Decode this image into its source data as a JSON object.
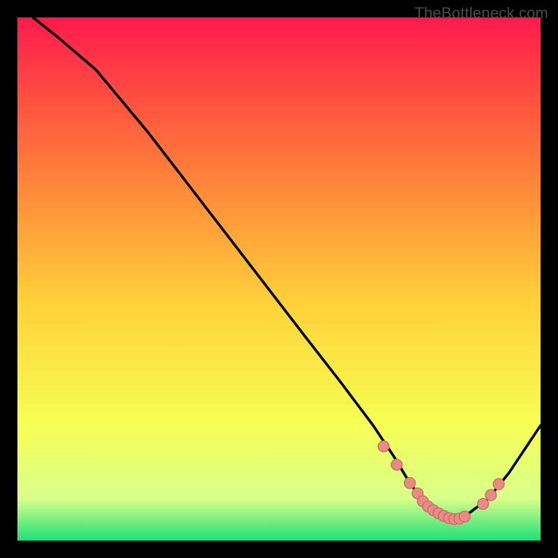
{
  "watermark": "TheBottleneck.com",
  "colors": {
    "frame": "#000000",
    "gradient_top": "#ff1a4b",
    "gradient_upper_mid": "#ff7a3a",
    "gradient_mid": "#ffd23a",
    "gradient_lower_mid": "#f6ff55",
    "gradient_low": "#d8ff8a",
    "gradient_bottom": "#1fe07a",
    "curve_stroke": "#000000",
    "marker_fill": "#e98a84",
    "marker_stroke": "#c86a64"
  },
  "chart_data": {
    "type": "line",
    "title": "",
    "xlabel": "",
    "ylabel": "",
    "xlim": [
      0,
      100
    ],
    "ylim": [
      0,
      100
    ],
    "series": [
      {
        "name": "bottleneck-curve",
        "x": [
          3,
          8,
          15,
          25,
          35,
          45,
          55,
          62,
          68,
          72,
          75,
          78,
          80,
          82,
          84,
          86,
          90,
          94,
          100
        ],
        "y": [
          100,
          96,
          90,
          78,
          65,
          52,
          39,
          30,
          22,
          16,
          11,
          7,
          5,
          4,
          4,
          5,
          8,
          13,
          22
        ]
      }
    ],
    "markers": {
      "name": "highlight-points",
      "x": [
        70,
        72.5,
        75,
        76.5,
        77.5,
        78.5,
        79.5,
        80.5,
        81.5,
        82.5,
        83.5,
        84.5,
        85.5,
        89,
        90.5,
        92
      ],
      "y": [
        18,
        14.5,
        11,
        9,
        7.5,
        6.5,
        5.8,
        5.2,
        4.7,
        4.3,
        4.1,
        4.2,
        4.6,
        7,
        8.7,
        10.8
      ]
    }
  }
}
